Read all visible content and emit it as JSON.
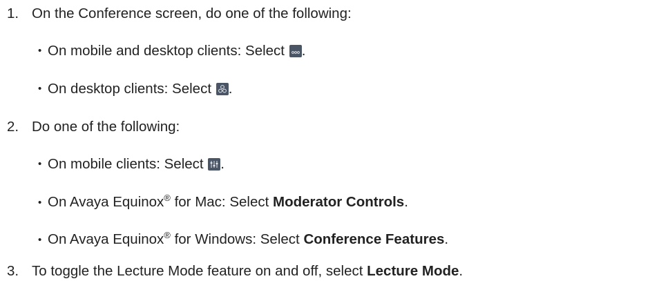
{
  "steps": [
    {
      "number": "1.",
      "text": "On the Conference screen, do one of the following:",
      "bullets": [
        {
          "text": "On mobile and desktop clients: Select ",
          "icon": "more-options-icon",
          "after": "."
        },
        {
          "text": "On desktop clients: Select ",
          "icon": "participants-icon",
          "after": "."
        }
      ]
    },
    {
      "number": "2.",
      "text": "Do one of the following:",
      "bullets": [
        {
          "text": "On mobile clients: Select ",
          "icon": "moderator-controls-icon",
          "after": "."
        },
        {
          "pre": "On Avaya Equinox",
          "reg": "®",
          "mid": " for Mac: Select ",
          "bold": "Moderator Controls",
          "after": "."
        },
        {
          "pre": "On Avaya Equinox",
          "reg": "®",
          "mid": " for Windows: Select ",
          "bold": "Conference Features",
          "after": "."
        }
      ]
    },
    {
      "number": "3.",
      "text": "To toggle the Lecture Mode feature on and off, select ",
      "bold": "Lecture Mode",
      "after": "."
    }
  ],
  "bullet_glyph": "•",
  "colors": {
    "text": "#222222",
    "icon_background": "#4a5566",
    "icon_foreground": "#e6e9ee"
  }
}
